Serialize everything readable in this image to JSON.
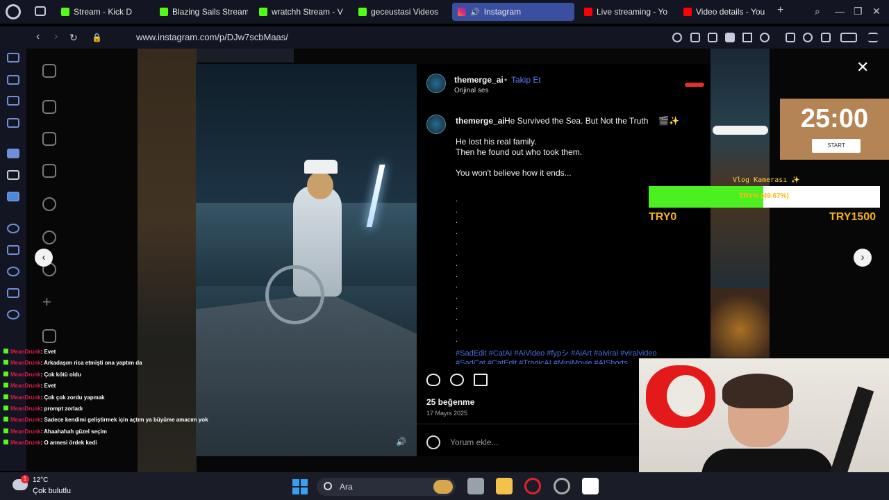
{
  "browser": {
    "tabs": [
      {
        "label": "Stream - Kick D",
        "icon": "kick-icon"
      },
      {
        "label": "Blazing Sails Stream",
        "icon": "kick-icon"
      },
      {
        "label": "wratchh Stream - V",
        "icon": "kick-icon"
      },
      {
        "label": "geceustasi Videos",
        "icon": "kick-icon"
      },
      {
        "label": "Instagram",
        "icon": "instagram-icon",
        "active": true
      },
      {
        "label": "Live streaming - Yo",
        "icon": "youtube-icon"
      },
      {
        "label": "Video details - You",
        "icon": "youtube-icon"
      }
    ],
    "url": "www.instagram.com/p/DJw7scbMaas/"
  },
  "post": {
    "username": "themerge_ai",
    "follow_label": "Takip Et",
    "follow_sep": "•",
    "audio": "Orijinal ses",
    "caption_title": "He Survived the Sea. But Not the Truth",
    "caption_line1": "He lost his real family.",
    "caption_line2": "Then he found out who took them.",
    "caption_line3": "You won't believe how it ends...",
    "dots": ".\n.\n.\n.\n.\n.\n.\n.\n.\n.\n.\n.\n.\n.",
    "hashtags": "#SadEdit #CatAI #AiVideo #fypシ #AiArt #aiviral #viralvideo #SadCat #CatEdit #TragicAI #MiniMovie #AIShorts",
    "likes": "25 beğenme",
    "date": "17 Mayıs 2025",
    "comment_placeholder": "Yorum ekle..."
  },
  "overlay": {
    "timer": "25:00",
    "timer_button": "START",
    "goal_title": "Vlog Kamerası ✨",
    "goal_text": "TRY% (49.67%)",
    "goal_fraction": 0.4967,
    "goal_min": "TRY0",
    "goal_max": "TRY1500"
  },
  "chat": [
    {
      "user": "MeanDrunk",
      "msg": ": Evet"
    },
    {
      "user": "MeanDrunk",
      "msg": ": Arkadaşım rica etmişti ona yaptım da"
    },
    {
      "user": "MeanDrunk",
      "msg": ": Çok kötü oldu"
    },
    {
      "user": "MeanDrunk",
      "msg": ": Evet"
    },
    {
      "user": "MeanDrunk",
      "msg": ": Çok çok zordu yapmak"
    },
    {
      "user": "MeanDrunk",
      "msg": ": prompt zorladı"
    },
    {
      "user": "MeanDrunk",
      "msg": ": Sadece kendimi geliştirmek için açtım ya büyüme amacım yok"
    },
    {
      "user": "MeanDrunk",
      "msg": ": Ahaahahah güzel seçim"
    },
    {
      "user": "MeanDrunk",
      "msg": ": O annesi ördek kedi"
    }
  ],
  "taskbar": {
    "temp": "12°C",
    "weather": "Çok bulutlu",
    "weather_badge": "1",
    "search_label": "Ara"
  },
  "colors": {
    "accent_tab": "#3b4fa0",
    "follow_link": "#5a7dff",
    "goal_fill": "#4cf020",
    "chat_user": "#e0184a",
    "timer_bg": "#b58455"
  }
}
